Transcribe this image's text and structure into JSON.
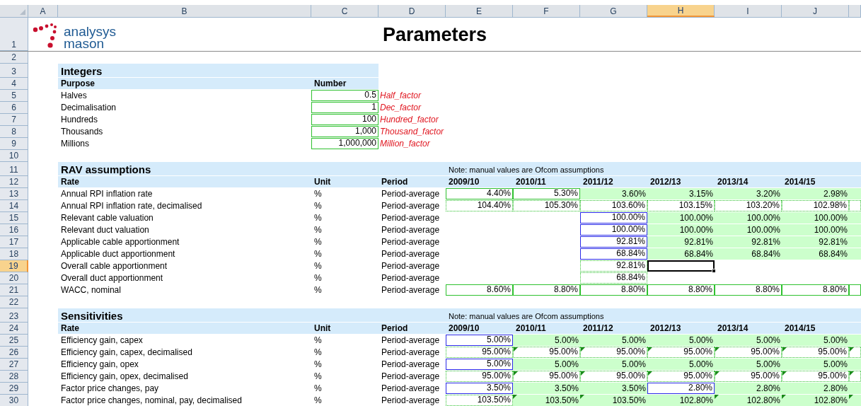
{
  "columns": [
    {
      "label": "A",
      "selected": false
    },
    {
      "label": "B",
      "selected": false
    },
    {
      "label": "C",
      "selected": false
    },
    {
      "label": "D",
      "selected": false
    },
    {
      "label": "E",
      "selected": false
    },
    {
      "label": "F",
      "selected": false
    },
    {
      "label": "G",
      "selected": false
    },
    {
      "label": "H",
      "selected": true
    },
    {
      "label": "I",
      "selected": false
    },
    {
      "label": "J",
      "selected": false
    }
  ],
  "rows": [
    {
      "number": "1",
      "selected": false,
      "kind": "logo",
      "cells": {
        "A": {
          "kind": "logo",
          "text": "analysys",
          "text2": "mason"
        },
        "D": {
          "kind": "page_title",
          "text": "Parameters"
        }
      }
    },
    {
      "number": "2",
      "selected": false,
      "kind": "plain",
      "cells": {}
    },
    {
      "number": "3",
      "selected": false,
      "kind": "section",
      "band": true,
      "cells": {
        "B": {
          "kind": "section_title",
          "text": "Integers"
        }
      }
    },
    {
      "number": "4",
      "selected": false,
      "kind": "plain",
      "band": true,
      "cells": {
        "B": {
          "kind": "heading",
          "text": "Purpose"
        },
        "C": {
          "kind": "heading",
          "text": "Number"
        }
      }
    },
    {
      "number": "5",
      "selected": false,
      "kind": "plain",
      "cells": {
        "B": {
          "kind": "label",
          "text": "Halves"
        },
        "C": {
          "kind": "input",
          "text": "0.5"
        },
        "D": {
          "kind": "name",
          "text": "Half_factor"
        }
      }
    },
    {
      "number": "6",
      "selected": false,
      "kind": "plain",
      "cells": {
        "B": {
          "kind": "label",
          "text": "Decimalisation"
        },
        "C": {
          "kind": "input",
          "text": "1"
        },
        "D": {
          "kind": "name",
          "text": "Dec_factor"
        }
      }
    },
    {
      "number": "7",
      "selected": false,
      "kind": "plain",
      "cells": {
        "B": {
          "kind": "label",
          "text": "Hundreds"
        },
        "C": {
          "kind": "input",
          "text": "100"
        },
        "D": {
          "kind": "name",
          "text": "Hundred_factor"
        }
      }
    },
    {
      "number": "8",
      "selected": false,
      "kind": "plain",
      "cells": {
        "B": {
          "kind": "label",
          "text": "Thousands"
        },
        "C": {
          "kind": "input",
          "text": "1,000"
        },
        "D": {
          "kind": "name",
          "text": "Thousand_factor"
        }
      }
    },
    {
      "number": "9",
      "selected": false,
      "kind": "plain",
      "cells": {
        "B": {
          "kind": "label",
          "text": "Millions"
        },
        "C": {
          "kind": "input",
          "text": "1,000,000"
        },
        "D": {
          "kind": "name",
          "text": "Million_factor"
        }
      }
    },
    {
      "number": "10",
      "selected": false,
      "kind": "plain",
      "cells": {}
    },
    {
      "number": "11",
      "selected": false,
      "kind": "section",
      "band": true,
      "band_wide": true,
      "cells": {
        "B": {
          "kind": "section_title",
          "text": "RAV assumptions"
        },
        "E": {
          "kind": "note",
          "text": "Note: manual values are Ofcom assumptions"
        }
      }
    },
    {
      "number": "12",
      "selected": false,
      "kind": "plain",
      "band": true,
      "band_wide": true,
      "cells": {
        "B": {
          "kind": "heading",
          "text": "Rate"
        },
        "C": {
          "kind": "heading",
          "text": "Unit"
        },
        "D": {
          "kind": "heading",
          "text": "Period"
        },
        "E": {
          "kind": "heading",
          "text": "2009/10"
        },
        "F": {
          "kind": "heading",
          "text": "2010/11"
        },
        "G": {
          "kind": "heading",
          "text": "2011/12"
        },
        "H": {
          "kind": "heading",
          "text": "2012/13"
        },
        "I": {
          "kind": "heading",
          "text": "2013/14"
        },
        "J": {
          "kind": "heading",
          "text": "2014/15"
        }
      }
    },
    {
      "number": "13",
      "selected": false,
      "kind": "plain",
      "cells": {
        "B": {
          "kind": "label",
          "text": "Annual RPI inflation rate"
        },
        "C": {
          "kind": "label",
          "text": "%"
        },
        "D": {
          "kind": "label",
          "text": "Period-average"
        },
        "E": {
          "kind": "input",
          "text": "4.40%"
        },
        "F": {
          "kind": "input",
          "text": "5.30%"
        },
        "G": {
          "kind": "calc",
          "text": "3.60%"
        },
        "H": {
          "kind": "calc",
          "text": "3.15%"
        },
        "I": {
          "kind": "calc",
          "text": "3.20%"
        },
        "J": {
          "kind": "calc",
          "text": "2.98%"
        },
        "K": {
          "kind": "calc"
        }
      }
    },
    {
      "number": "14",
      "selected": false,
      "kind": "plain",
      "cells": {
        "B": {
          "kind": "label",
          "text": "Annual RPI inflation rate, decimalised"
        },
        "C": {
          "kind": "label",
          "text": "%"
        },
        "D": {
          "kind": "label",
          "text": "Period-average"
        },
        "E": {
          "kind": "formula",
          "text": "104.40%"
        },
        "F": {
          "kind": "formula",
          "text": "105.30%"
        },
        "G": {
          "kind": "formula",
          "text": "103.60%"
        },
        "H": {
          "kind": "formula",
          "text": "103.15%"
        },
        "I": {
          "kind": "formula",
          "text": "103.20%"
        },
        "J": {
          "kind": "formula",
          "text": "102.98%"
        },
        "K": {
          "kind": "formula"
        }
      }
    },
    {
      "number": "15",
      "selected": false,
      "kind": "plain",
      "cells": {
        "B": {
          "kind": "label",
          "text": "Relevant cable valuation"
        },
        "C": {
          "kind": "label",
          "text": "%"
        },
        "D": {
          "kind": "label",
          "text": "Period-average"
        },
        "G": {
          "kind": "override",
          "text": "100.00%"
        },
        "H": {
          "kind": "calc",
          "text": "100.00%"
        },
        "I": {
          "kind": "calc",
          "text": "100.00%"
        },
        "J": {
          "kind": "calc",
          "text": "100.00%"
        },
        "K": {
          "kind": "calc"
        }
      }
    },
    {
      "number": "16",
      "selected": false,
      "kind": "plain",
      "cells": {
        "B": {
          "kind": "label",
          "text": "Relevant duct valuation"
        },
        "C": {
          "kind": "label",
          "text": "%"
        },
        "D": {
          "kind": "label",
          "text": "Period-average"
        },
        "G": {
          "kind": "override",
          "text": "100.00%"
        },
        "H": {
          "kind": "calc",
          "text": "100.00%"
        },
        "I": {
          "kind": "calc",
          "text": "100.00%"
        },
        "J": {
          "kind": "calc",
          "text": "100.00%"
        },
        "K": {
          "kind": "calc"
        }
      }
    },
    {
      "number": "17",
      "selected": false,
      "kind": "plain",
      "cells": {
        "B": {
          "kind": "label",
          "text": "Applicable cable apportionment"
        },
        "C": {
          "kind": "label",
          "text": "%"
        },
        "D": {
          "kind": "label",
          "text": "Period-average"
        },
        "G": {
          "kind": "override",
          "text": "92.81%"
        },
        "H": {
          "kind": "calc",
          "text": "92.81%"
        },
        "I": {
          "kind": "calc",
          "text": "92.81%"
        },
        "J": {
          "kind": "calc",
          "text": "92.81%"
        },
        "K": {
          "kind": "calc"
        }
      }
    },
    {
      "number": "18",
      "selected": false,
      "kind": "plain",
      "cells": {
        "B": {
          "kind": "label",
          "text": "Applicable duct apportionment"
        },
        "C": {
          "kind": "label",
          "text": "%"
        },
        "D": {
          "kind": "label",
          "text": "Period-average"
        },
        "G": {
          "kind": "override",
          "text": "68.84%"
        },
        "H": {
          "kind": "calc",
          "text": "68.84%"
        },
        "I": {
          "kind": "calc",
          "text": "68.84%"
        },
        "J": {
          "kind": "calc",
          "text": "68.84%"
        },
        "K": {
          "kind": "calc"
        }
      }
    },
    {
      "number": "19",
      "selected": true,
      "kind": "plain",
      "cells": {
        "B": {
          "kind": "label",
          "text": "Overall cable apportionment"
        },
        "C": {
          "kind": "label",
          "text": "%"
        },
        "D": {
          "kind": "label",
          "text": "Period-average"
        },
        "G": {
          "kind": "formula",
          "text": "92.81%"
        },
        "H": {
          "kind": "active"
        }
      }
    },
    {
      "number": "20",
      "selected": false,
      "kind": "plain",
      "cells": {
        "B": {
          "kind": "label",
          "text": "Overall duct apportionment"
        },
        "C": {
          "kind": "label",
          "text": "%"
        },
        "D": {
          "kind": "label",
          "text": "Period-average"
        },
        "G": {
          "kind": "formula",
          "text": "68.84%"
        }
      }
    },
    {
      "number": "21",
      "selected": false,
      "kind": "plain",
      "cells": {
        "B": {
          "kind": "label",
          "text": "WACC, nominal"
        },
        "C": {
          "kind": "label",
          "text": "%"
        },
        "D": {
          "kind": "label",
          "text": "Period-average"
        },
        "E": {
          "kind": "input",
          "text": "8.60%"
        },
        "F": {
          "kind": "input",
          "text": "8.80%"
        },
        "G": {
          "kind": "input",
          "text": "8.80%"
        },
        "H": {
          "kind": "input",
          "text": "8.80%"
        },
        "I": {
          "kind": "input",
          "text": "8.80%"
        },
        "J": {
          "kind": "input",
          "text": "8.80%"
        },
        "K": {
          "kind": "input"
        }
      }
    },
    {
      "number": "22",
      "selected": false,
      "kind": "plain",
      "cells": {}
    },
    {
      "number": "23",
      "selected": false,
      "kind": "section",
      "band": true,
      "band_wide": true,
      "cells": {
        "B": {
          "kind": "section_title",
          "text": "Sensitivities"
        },
        "E": {
          "kind": "note",
          "text": "Note: manual values are Ofcom assumptions"
        }
      }
    },
    {
      "number": "24",
      "selected": false,
      "kind": "plain",
      "band": true,
      "band_wide": true,
      "cells": {
        "B": {
          "kind": "heading",
          "text": "Rate"
        },
        "C": {
          "kind": "heading",
          "text": "Unit"
        },
        "D": {
          "kind": "heading",
          "text": "Period"
        },
        "E": {
          "kind": "heading",
          "text": "2009/10"
        },
        "F": {
          "kind": "heading",
          "text": "2010/11"
        },
        "G": {
          "kind": "heading",
          "text": "2011/12"
        },
        "H": {
          "kind": "heading",
          "text": "2012/13"
        },
        "I": {
          "kind": "heading",
          "text": "2013/14"
        },
        "J": {
          "kind": "heading",
          "text": "2014/15"
        }
      }
    },
    {
      "number": "25",
      "selected": false,
      "kind": "plain",
      "cells": {
        "B": {
          "kind": "label",
          "text": "Efficiency gain, capex"
        },
        "C": {
          "kind": "label",
          "text": "%"
        },
        "D": {
          "kind": "label",
          "text": "Period-average"
        },
        "E": {
          "kind": "override",
          "text": "5.00%"
        },
        "F": {
          "kind": "calc",
          "text": "5.00%"
        },
        "G": {
          "kind": "calc",
          "text": "5.00%"
        },
        "H": {
          "kind": "calc",
          "text": "5.00%"
        },
        "I": {
          "kind": "calc",
          "text": "5.00%"
        },
        "J": {
          "kind": "calc",
          "text": "5.00%"
        },
        "K": {
          "kind": "calc"
        }
      }
    },
    {
      "number": "26",
      "selected": false,
      "kind": "plain",
      "cells": {
        "B": {
          "kind": "label",
          "text": "Efficiency gain, capex, decimalised"
        },
        "C": {
          "kind": "label",
          "text": "%"
        },
        "D": {
          "kind": "label",
          "text": "Period-average"
        },
        "E": {
          "kind": "formula",
          "text": "95.00%"
        },
        "F": {
          "kind": "formula",
          "text": "95.00%",
          "flag": true
        },
        "G": {
          "kind": "formula",
          "text": "95.00%",
          "flag": true
        },
        "H": {
          "kind": "formula",
          "text": "95.00%",
          "flag": true
        },
        "I": {
          "kind": "formula",
          "text": "95.00%",
          "flag": true
        },
        "J": {
          "kind": "formula",
          "text": "95.00%",
          "flag": true
        },
        "K": {
          "kind": "formula",
          "flag": true
        }
      }
    },
    {
      "number": "27",
      "selected": false,
      "kind": "plain",
      "cells": {
        "B": {
          "kind": "label",
          "text": "Efficiency gain, opex"
        },
        "C": {
          "kind": "label",
          "text": "%"
        },
        "D": {
          "kind": "label",
          "text": "Period-average"
        },
        "E": {
          "kind": "override",
          "text": "5.00%"
        },
        "F": {
          "kind": "calc",
          "text": "5.00%"
        },
        "G": {
          "kind": "calc",
          "text": "5.00%"
        },
        "H": {
          "kind": "calc",
          "text": "5.00%"
        },
        "I": {
          "kind": "calc",
          "text": "5.00%"
        },
        "J": {
          "kind": "calc",
          "text": "5.00%"
        },
        "K": {
          "kind": "calc"
        }
      }
    },
    {
      "number": "28",
      "selected": false,
      "kind": "plain",
      "cells": {
        "B": {
          "kind": "label",
          "text": "Efficiency gain, opex, decimalised"
        },
        "C": {
          "kind": "label",
          "text": "%"
        },
        "D": {
          "kind": "label",
          "text": "Period-average"
        },
        "E": {
          "kind": "formula",
          "text": "95.00%"
        },
        "F": {
          "kind": "formula",
          "text": "95.00%",
          "flag": true
        },
        "G": {
          "kind": "formula",
          "text": "95.00%",
          "flag": true
        },
        "H": {
          "kind": "formula",
          "text": "95.00%",
          "flag": true
        },
        "I": {
          "kind": "formula",
          "text": "95.00%",
          "flag": true
        },
        "J": {
          "kind": "formula",
          "text": "95.00%",
          "flag": true
        },
        "K": {
          "kind": "formula",
          "flag": true
        }
      }
    },
    {
      "number": "29",
      "selected": false,
      "kind": "plain",
      "cells": {
        "B": {
          "kind": "label",
          "text": "Factor price changes, pay"
        },
        "C": {
          "kind": "label",
          "text": "%"
        },
        "D": {
          "kind": "label",
          "text": "Period-average"
        },
        "E": {
          "kind": "override",
          "text": "3.50%"
        },
        "F": {
          "kind": "calc",
          "text": "3.50%"
        },
        "G": {
          "kind": "calc",
          "text": "3.50%"
        },
        "H": {
          "kind": "override",
          "text": "2.80%"
        },
        "I": {
          "kind": "calc",
          "text": "2.80%"
        },
        "J": {
          "kind": "calc",
          "text": "2.80%"
        },
        "K": {
          "kind": "calc"
        }
      }
    },
    {
      "number": "30",
      "selected": false,
      "kind": "plain",
      "cells": {
        "B": {
          "kind": "label",
          "text": "Factor price changes, nominal, pay, decimalised"
        },
        "C": {
          "kind": "label",
          "text": "%"
        },
        "D": {
          "kind": "label",
          "text": "Period-average"
        },
        "E": {
          "kind": "formula",
          "text": "103.50%"
        },
        "F": {
          "kind": "calc",
          "text": "103.50%",
          "flag": true
        },
        "G": {
          "kind": "calc",
          "text": "103.50%",
          "flag": true
        },
        "H": {
          "kind": "calc",
          "text": "102.80%"
        },
        "I": {
          "kind": "calc",
          "text": "102.80%",
          "flag": true
        },
        "J": {
          "kind": "calc",
          "text": "102.80%",
          "flag": true
        },
        "K": {
          "kind": "calc",
          "flag": true
        }
      }
    }
  ]
}
